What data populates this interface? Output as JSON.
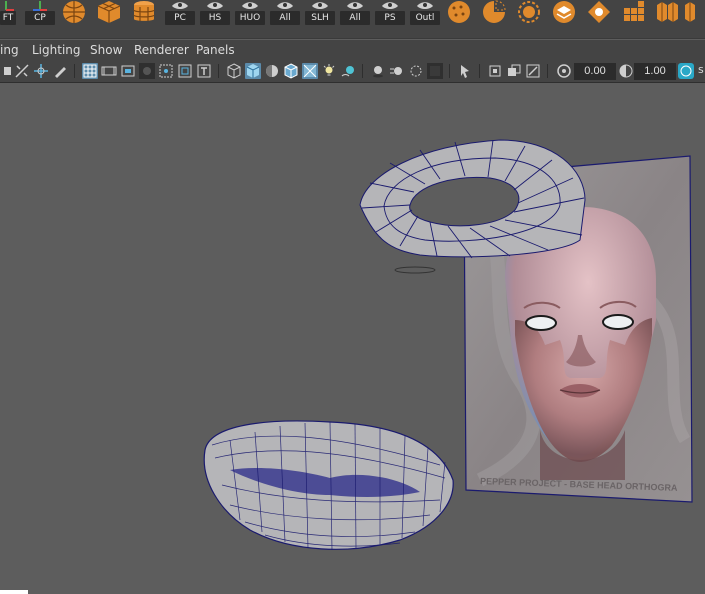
{
  "shelf": {
    "left_labels": [
      "FT",
      "CP"
    ],
    "buttons": [
      "PC",
      "HS",
      "HUO",
      "All",
      "SLH",
      "All",
      "PS",
      "Outl"
    ]
  },
  "menubar": {
    "items": [
      "ing",
      "Lighting",
      "Show",
      "Renderer",
      "Panels"
    ]
  },
  "toolbar": {
    "field_a": "0.00",
    "field_b": "1.00",
    "trailing_text": "s"
  },
  "viewport": {
    "reference_plane_caption": "PEPPER PROJECT - BASE HEAD ORTHOGRA",
    "wire_color": "#1a1a6e",
    "mesh_color": "#b5b5b8"
  },
  "colors": {
    "ui_dark": "#444444",
    "viewport_bg": "#5d5d5d",
    "accent_blue": "#5b8bab",
    "icon_orange": "#e08a2c"
  }
}
